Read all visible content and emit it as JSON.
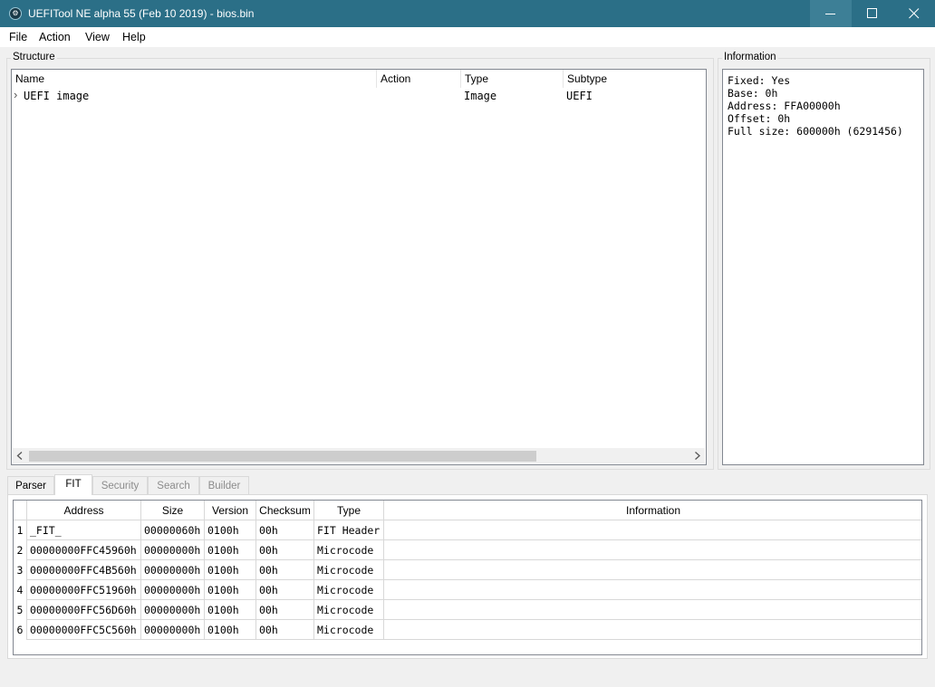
{
  "window": {
    "title": "UEFITool NE alpha 55 (Feb 10 2019) - bios.bin"
  },
  "menu": [
    "File",
    "Action",
    "View",
    "Help"
  ],
  "structure": {
    "group_title": "Structure",
    "columns": [
      "Name",
      "Action",
      "Type",
      "Subtype"
    ],
    "rows": [
      {
        "expander": "›",
        "name": "UEFI image",
        "action": "",
        "type": "Image",
        "subtype": "UEFI"
      }
    ]
  },
  "information": {
    "group_title": "Information",
    "lines": [
      "Fixed: Yes",
      "Base: 0h",
      "Address: FFA00000h",
      "Offset: 0h",
      "Full size: 600000h (6291456)"
    ]
  },
  "tabs": [
    {
      "label": "Parser",
      "state": "normal"
    },
    {
      "label": "FIT",
      "state": "active"
    },
    {
      "label": "Security",
      "state": "disabled"
    },
    {
      "label": "Search",
      "state": "disabled"
    },
    {
      "label": "Builder",
      "state": "disabled"
    }
  ],
  "fit": {
    "columns": [
      "Address",
      "Size",
      "Version",
      "Checksum",
      "Type",
      "Information"
    ],
    "rows": [
      {
        "num": "1",
        "address": "_FIT_",
        "size": "00000060h",
        "version": "0100h",
        "checksum": "00h",
        "type": "FIT Header",
        "information": ""
      },
      {
        "num": "2",
        "address": "00000000FFC45960h",
        "size": "00000000h",
        "version": "0100h",
        "checksum": "00h",
        "type": "Microcode",
        "information": ""
      },
      {
        "num": "3",
        "address": "00000000FFC4B560h",
        "size": "00000000h",
        "version": "0100h",
        "checksum": "00h",
        "type": "Microcode",
        "information": ""
      },
      {
        "num": "4",
        "address": "00000000FFC51960h",
        "size": "00000000h",
        "version": "0100h",
        "checksum": "00h",
        "type": "Microcode",
        "information": ""
      },
      {
        "num": "5",
        "address": "00000000FFC56D60h",
        "size": "00000000h",
        "version": "0100h",
        "checksum": "00h",
        "type": "Microcode",
        "information": ""
      },
      {
        "num": "6",
        "address": "00000000FFC5C560h",
        "size": "00000000h",
        "version": "0100h",
        "checksum": "00h",
        "type": "Microcode",
        "information": ""
      }
    ]
  },
  "colors": {
    "titlebar": "#2b6f87",
    "window_bg": "#f0f0f0",
    "panel_bg": "#ffffff"
  }
}
